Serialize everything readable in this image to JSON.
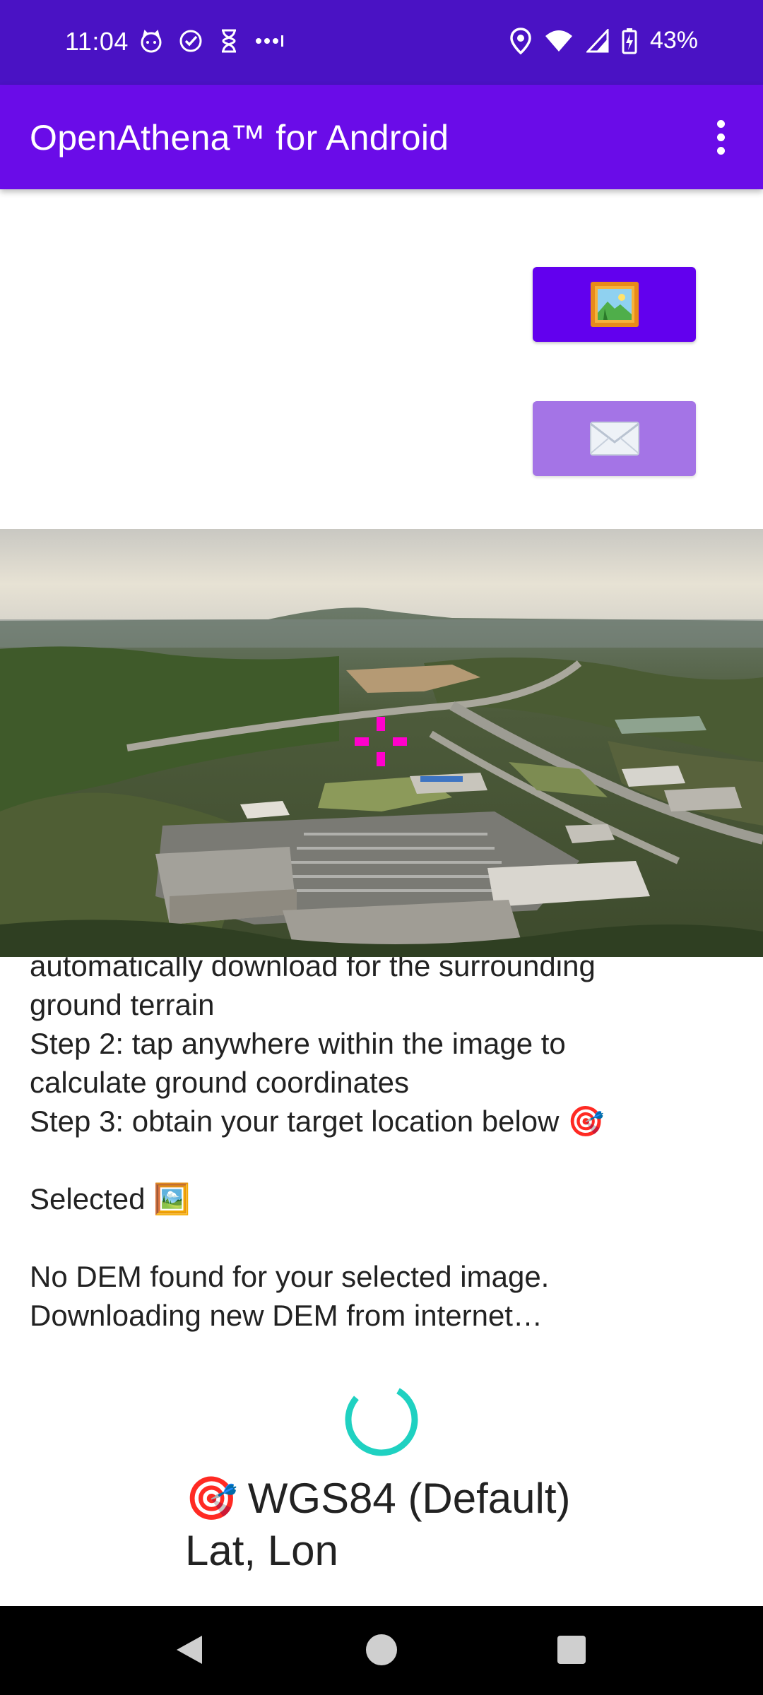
{
  "status_bar": {
    "time": "11:04",
    "battery": "43%",
    "icons": [
      "cat-face-icon",
      "check-circle-icon",
      "hourglass-icon",
      "more-dots-icon",
      "location-icon",
      "wifi-icon",
      "signal-icon",
      "battery-charging-icon"
    ]
  },
  "app_bar": {
    "title": "OpenAthena™ for Android",
    "menu_icon": "overflow-menu-icon"
  },
  "buttons": {
    "gallery_icon": "🖼️",
    "mail_icon": "✉️"
  },
  "instructions": {
    "line_partial": "automatically download for the surrounding",
    "line_1": "ground terrain",
    "line_2": "Step 2: tap anywhere within the image to",
    "line_3": "calculate ground coordinates",
    "line_4": "Step 3: obtain your target location below 🎯",
    "selected": "Selected 🖼️",
    "dem_1": "No DEM found for your selected image.",
    "dem_2": "Downloading new DEM from internet…"
  },
  "result": {
    "target_icon": "🎯",
    "coord_system": "WGS84 (Default)",
    "coords": "Lat, Lon"
  },
  "colors": {
    "status_bar": "#4a12c4",
    "app_bar": "#6a0ce8",
    "primary_button": "#6200ee",
    "secondary_button": "#a474e6",
    "spinner": "#1fd1c1",
    "crosshair": "#ff00cc"
  }
}
